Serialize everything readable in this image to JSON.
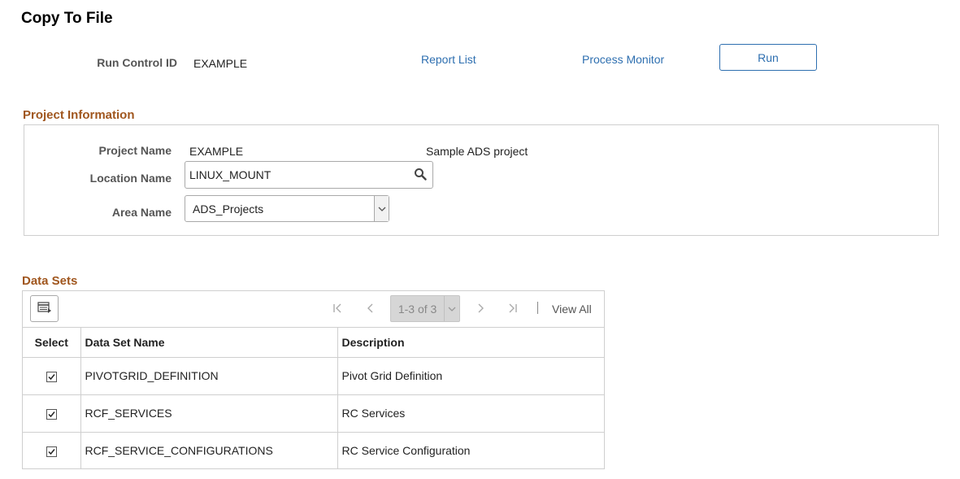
{
  "page": {
    "title": "Copy To File"
  },
  "header": {
    "run_control_label": "Run Control ID",
    "run_control_value": "EXAMPLE",
    "report_list_link": "Report List",
    "process_monitor_link": "Process Monitor",
    "run_button": "Run"
  },
  "project_info": {
    "section_title": "Project Information",
    "project_name_label": "Project Name",
    "project_name_value": "EXAMPLE",
    "project_description": "Sample ADS project",
    "location_name_label": "Location Name",
    "location_name_value": "LINUX_MOUNT",
    "area_name_label": "Area Name",
    "area_name_value": "ADS_Projects"
  },
  "data_sets": {
    "section_title": "Data Sets",
    "pager_text": "1-3 of 3",
    "view_all": "View All",
    "columns": [
      "Select",
      "Data Set Name",
      "Description"
    ],
    "rows": [
      {
        "selected": true,
        "name": "PIVOTGRID_DEFINITION",
        "description": "Pivot Grid Definition"
      },
      {
        "selected": true,
        "name": "RCF_SERVICES",
        "description": "RC Services"
      },
      {
        "selected": true,
        "name": "RCF_SERVICE_CONFIGURATIONS",
        "description": "RC Service Configuration"
      }
    ]
  },
  "icons": {
    "search": "search-icon",
    "dropdown": "chevron-down-icon",
    "grid_personalize": "grid-personalize-icon",
    "first": "first-page-icon",
    "previous": "previous-page-icon",
    "next": "next-page-icon",
    "last": "last-page-icon",
    "check": "check-icon"
  },
  "colors": {
    "link": "#2e6fb0",
    "section_title": "#a0561e",
    "border": "#cfcfcf"
  }
}
